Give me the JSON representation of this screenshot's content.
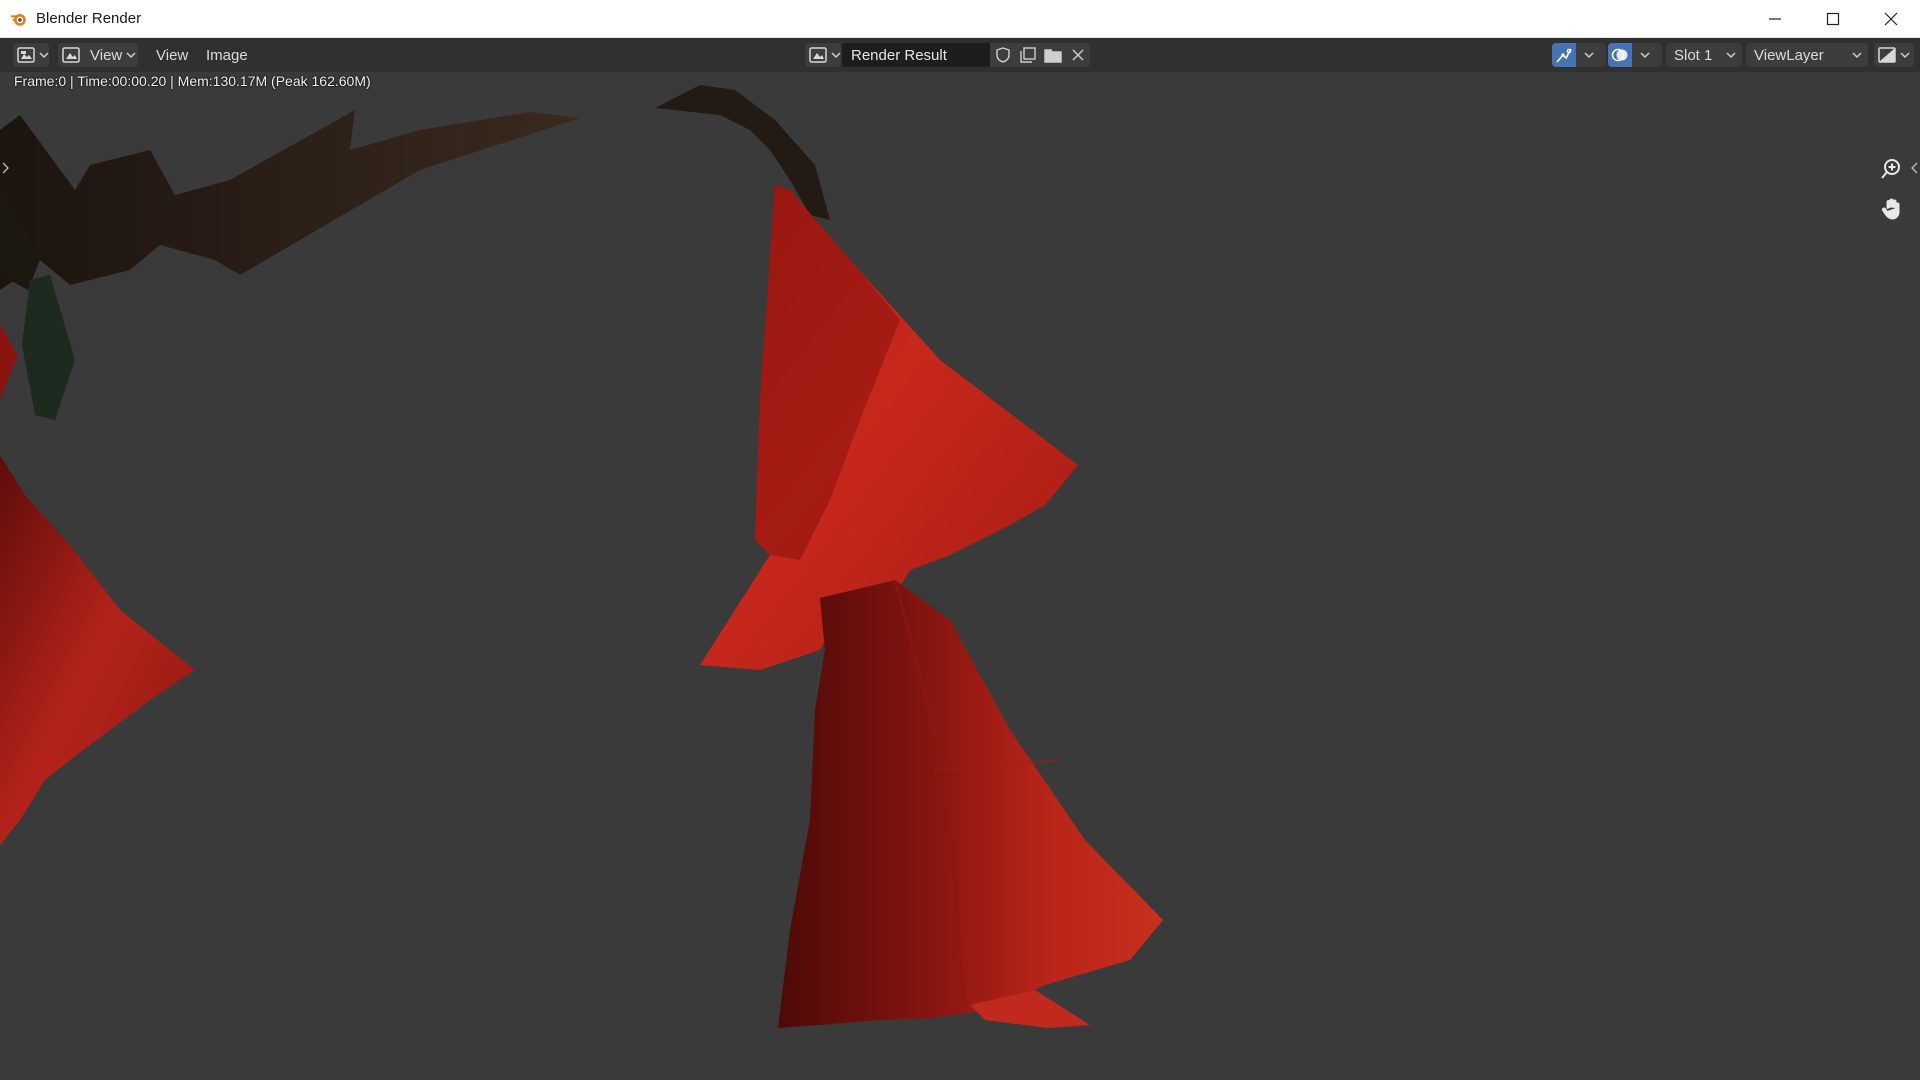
{
  "window": {
    "title": "Blender Render",
    "controls": [
      "minimize",
      "maximize",
      "close"
    ]
  },
  "header": {
    "editor_type_icon": "image-editor-icon",
    "view_mode_label": "View",
    "menus": {
      "view": "View",
      "image": "Image"
    },
    "image_name": "Render Result",
    "image_tools": [
      "fake-user-shield-icon",
      "new-image-icon",
      "open-image-folder-icon",
      "unlink-x-icon"
    ],
    "slot": "Slot 1",
    "view_layer": "ViewLayer",
    "accent_color": "#4772b3"
  },
  "viewport": {
    "status": "Frame:0 | Time:00:00.20 | Mem:130.17M (Peak 162.60M)",
    "background_color": "#3a3a3a",
    "navigation": [
      "zoom-icon",
      "pan-hand-icon"
    ]
  }
}
